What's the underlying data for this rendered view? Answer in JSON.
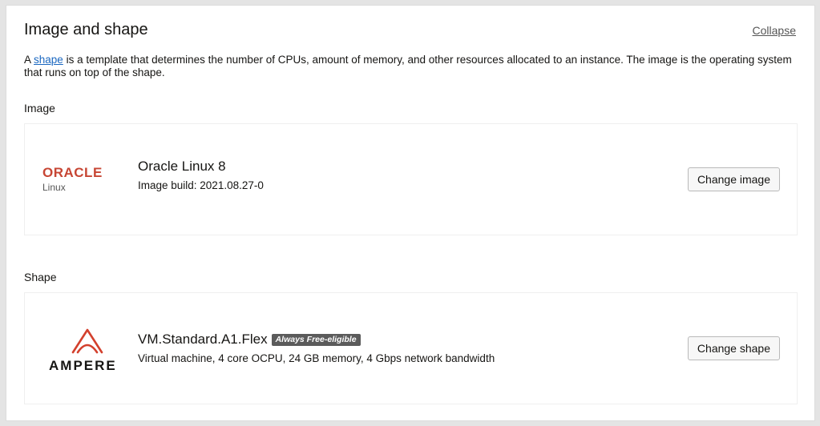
{
  "section": {
    "title": "Image and shape",
    "collapse_label": "Collapse",
    "description_prefix": "A ",
    "description_link": "shape",
    "description_rest": " is a template that determines the number of CPUs, amount of memory, and other resources allocated to an instance. The image is the operating system that runs on top of the shape."
  },
  "image": {
    "label": "Image",
    "logo_text": "ORACLE",
    "logo_subtext": "Linux",
    "name": "Oracle Linux 8",
    "build": "Image build: 2021.08.27-0",
    "change_button": "Change image"
  },
  "shape": {
    "label": "Shape",
    "logo_text": "AMPERE",
    "name": "VM.Standard.A1.Flex",
    "badge": "Always Free-eligible",
    "details": "Virtual machine, 4 core OCPU, 24 GB memory, 4 Gbps network bandwidth",
    "change_button": "Change shape"
  },
  "colors": {
    "oracle_red": "#c74634",
    "ampere_red": "#d3402d",
    "link_blue": "#1a67c0",
    "badge_bg": "#5b5b5b"
  }
}
